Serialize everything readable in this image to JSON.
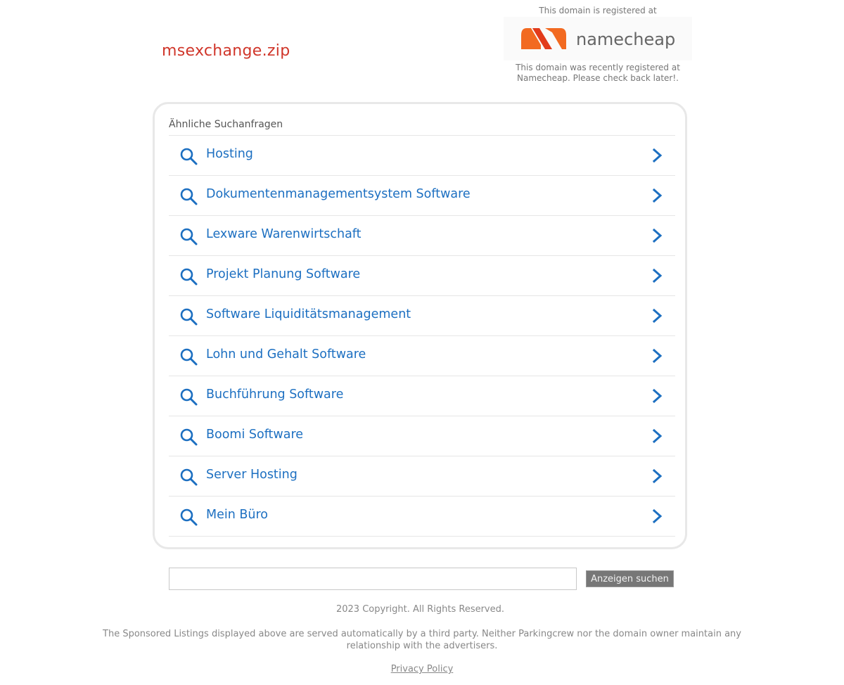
{
  "domain": {
    "name": "msexchange.zip"
  },
  "registrar": {
    "top_text": "This domain is registered at",
    "logo_text": "namecheap",
    "logo_colors": [
      "#f26a21",
      "#e23b1b"
    ],
    "bottom_text": "This domain was recently registered at Namecheap. Please check back later!."
  },
  "related": {
    "title": "Ähnliche Suchanfragen",
    "items": [
      {
        "label": "Hosting"
      },
      {
        "label": "Dokumentenmanagementsystem Software"
      },
      {
        "label": "Lexware Warenwirtschaft"
      },
      {
        "label": "Projekt Planung Software"
      },
      {
        "label": "Software Liquiditätsmanagement"
      },
      {
        "label": "Lohn und Gehalt Software"
      },
      {
        "label": "Buchführung Software"
      },
      {
        "label": "Boomi Software"
      },
      {
        "label": "Server Hosting"
      },
      {
        "label": "Mein Büro"
      }
    ]
  },
  "search": {
    "value": "",
    "button_label": "Anzeigen suchen"
  },
  "footer": {
    "copyright": "2023 Copyright. All Rights Reserved.",
    "disclaimer": "The Sponsored Listings displayed above are served automatically by a third party. Neither Parkingcrew nor the domain owner maintain any relationship with the advertisers.",
    "privacy_label": "Privacy Policy"
  },
  "colors": {
    "domain": "#d0362a",
    "link": "#1c6fc1",
    "icon": "#1c6fc1"
  }
}
